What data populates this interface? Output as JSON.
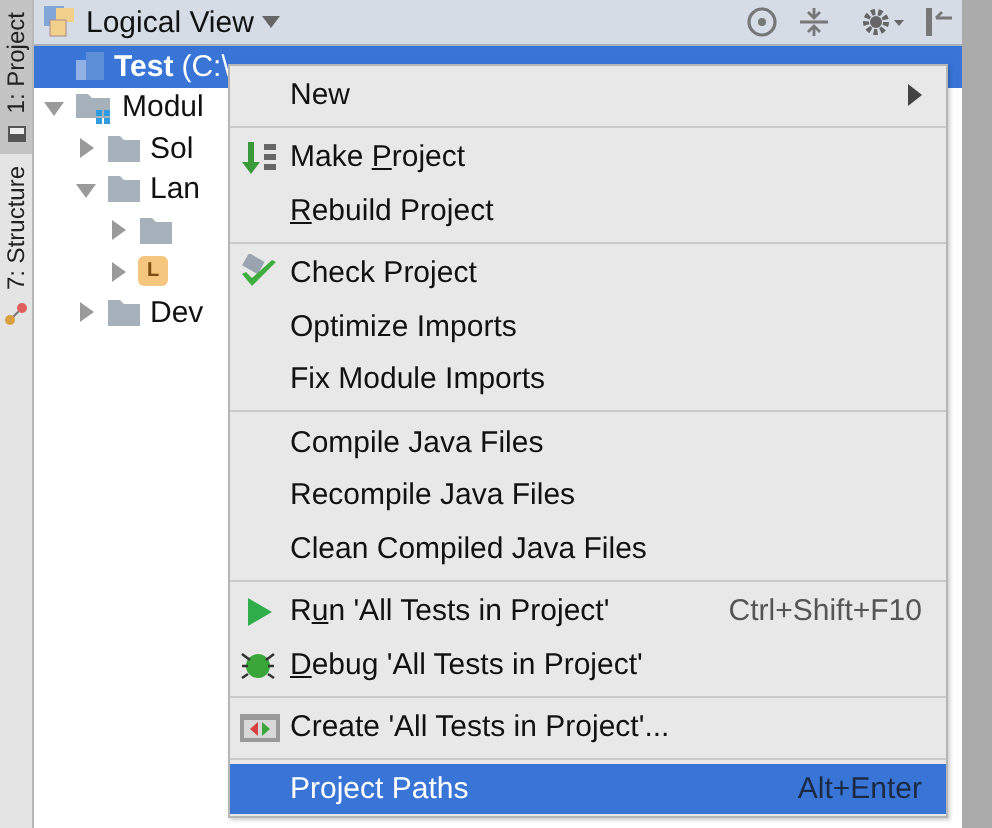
{
  "tool_strip": [
    {
      "label": "1: Project",
      "selected": true
    },
    {
      "label": "7: Structure",
      "selected": false
    }
  ],
  "header": {
    "title": "Logical View"
  },
  "tree": [
    {
      "label": "Test",
      "path": "(C:\\",
      "kind": "project",
      "selected": true
    },
    {
      "label": "Modul",
      "kind": "module",
      "expanded": true,
      "selected": false,
      "children": [
        {
          "label": "Sol",
          "kind": "folder",
          "expanded": false,
          "selected": false
        },
        {
          "label": "Lan",
          "kind": "folder",
          "expanded": true,
          "selected": false,
          "children": [
            {
              "kind": "folder",
              "expanded": false,
              "selected": false
            },
            {
              "kind": "language",
              "badge": "L",
              "expanded": false,
              "selected": false
            }
          ]
        },
        {
          "label": "Dev",
          "kind": "folder",
          "expanded": false,
          "selected": false
        }
      ]
    }
  ],
  "menu": [
    {
      "kind": "plain",
      "label_before": "New",
      "submenu": true,
      "selected": false
    },
    {
      "kind": "separator"
    },
    {
      "kind": "make",
      "label_before": "Make ",
      "mnemonic": "P",
      "label_after": "roject",
      "selected": false
    },
    {
      "kind": "plain",
      "mnemonic": "R",
      "label_after": "ebuild Project",
      "selected": false
    },
    {
      "kind": "separator"
    },
    {
      "kind": "check",
      "label_before": "Check Project",
      "selected": false
    },
    {
      "kind": "plain",
      "label_before": "Optimize Imports",
      "selected": false
    },
    {
      "kind": "plain",
      "label_before": "Fix Module Imports",
      "selected": false
    },
    {
      "kind": "separator"
    },
    {
      "kind": "plain",
      "label_before": "Compile Java Files",
      "selected": false
    },
    {
      "kind": "plain",
      "label_before": "Recompile Java Files",
      "selected": false
    },
    {
      "kind": "plain",
      "label_before": "Clean Compiled Java Files",
      "selected": false
    },
    {
      "kind": "separator"
    },
    {
      "kind": "run",
      "label_before": "R",
      "mnemonic": "u",
      "label_after": "n 'All Tests in Project'",
      "shortcut": "Ctrl+Shift+F10",
      "selected": false
    },
    {
      "kind": "debug",
      "mnemonic": "D",
      "label_after": "ebug 'All Tests in Project'",
      "selected": false
    },
    {
      "kind": "separator"
    },
    {
      "kind": "create",
      "label_before": "Create 'All Tests in Project'...",
      "selected": false
    },
    {
      "kind": "separator"
    },
    {
      "kind": "plain",
      "label_before": "Project Paths",
      "shortcut": "Alt+Enter",
      "selected": true
    }
  ]
}
